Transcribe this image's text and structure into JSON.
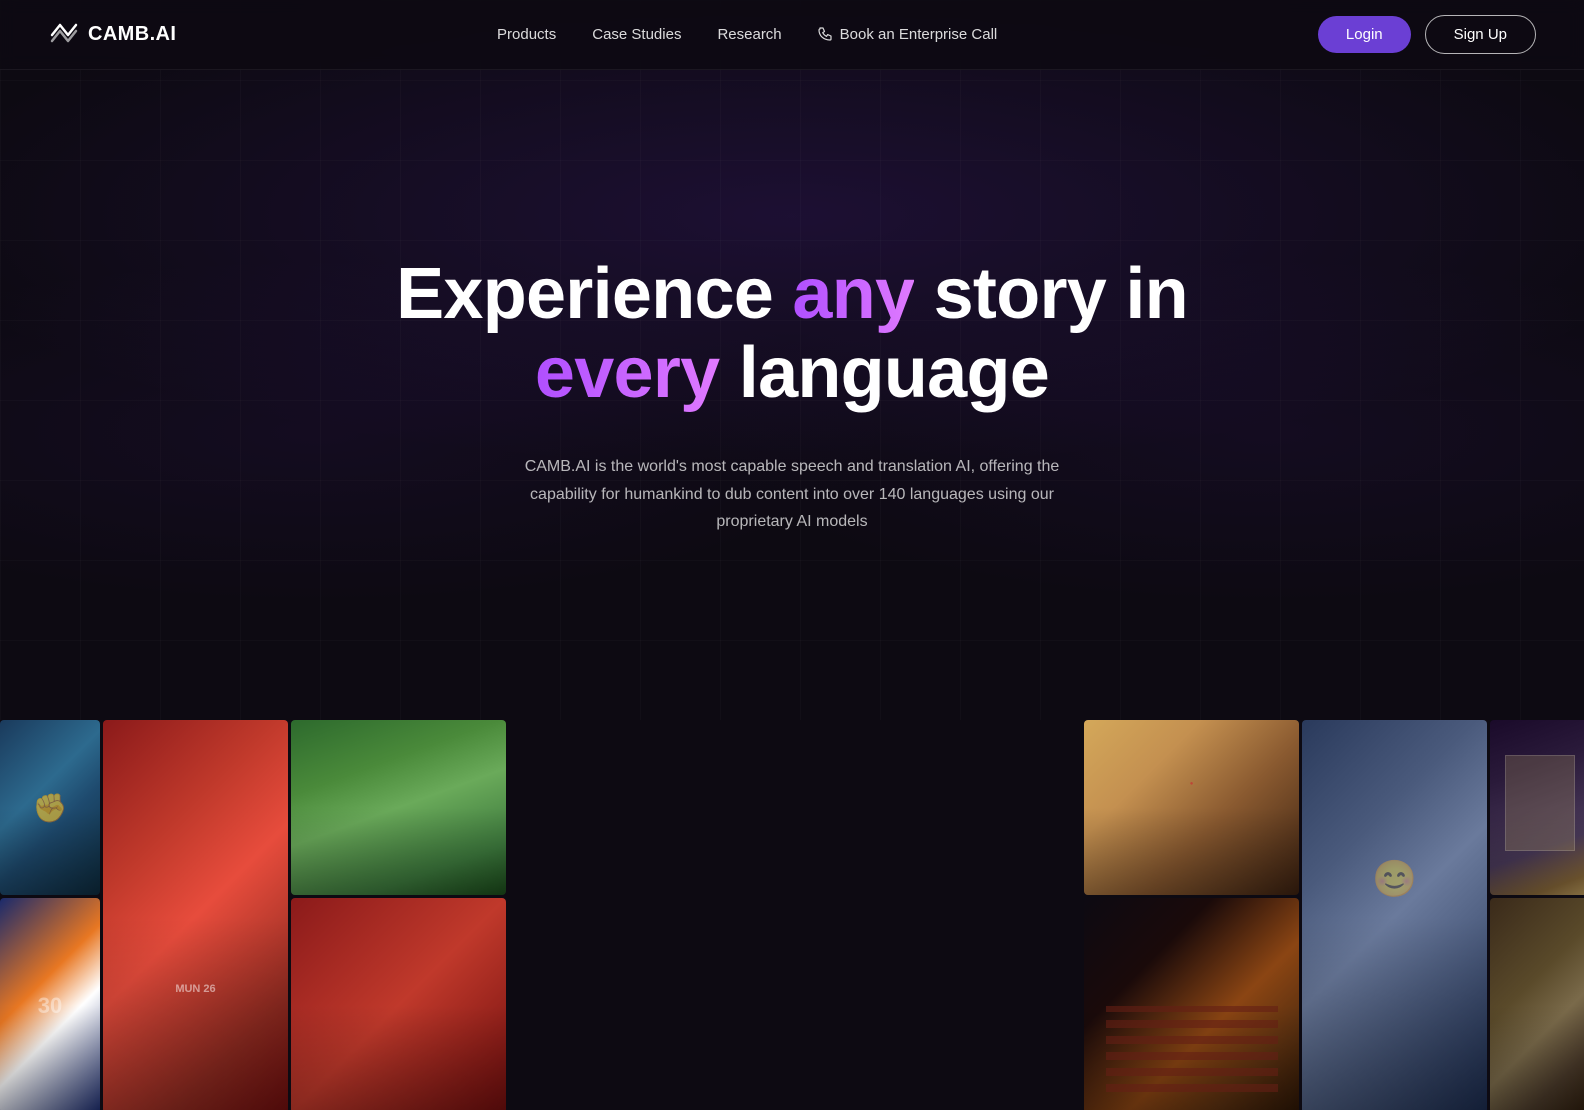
{
  "nav": {
    "logo_text": "CAMB.AI",
    "links": [
      {
        "label": "Products",
        "id": "products"
      },
      {
        "label": "Case Studies",
        "id": "case-studies"
      },
      {
        "label": "Research",
        "id": "research"
      },
      {
        "label": "Book an Enterprise Call",
        "id": "enterprise"
      }
    ],
    "login_label": "Login",
    "signup_label": "Sign Up"
  },
  "hero": {
    "title_line1_part1": "Experience ",
    "title_line1_highlight": "any",
    "title_line1_part2": " story in",
    "title_line2_highlight": "every",
    "title_line2_part2": " language",
    "description": "CAMB.AI is the world's most capable speech and translation AI, offering the capability for humankind to dub content into over 140 languages using our proprietary AI models"
  },
  "colors": {
    "accent_purple": "#6b3fd4",
    "highlight_gradient_start": "#b04fff",
    "highlight_gradient_end": "#e07aff",
    "background": "#0d0a12"
  }
}
